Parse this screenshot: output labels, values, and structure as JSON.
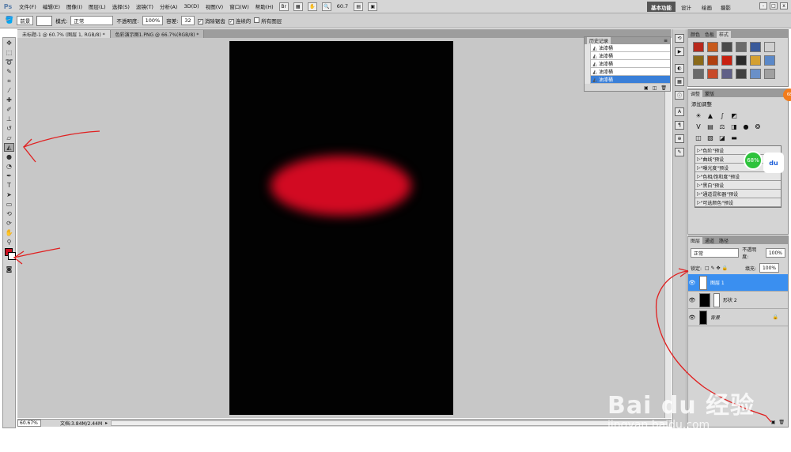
{
  "app": {
    "logo": "Ps"
  },
  "menu": [
    "文件(F)",
    "编辑(E)",
    "图像(I)",
    "图层(L)",
    "选择(S)",
    "滤镜(T)",
    "分析(A)",
    "3D(D)",
    "视图(V)",
    "窗口(W)",
    "帮助(H)"
  ],
  "menubar": {
    "zoom": "60.7",
    "workspaces": [
      "基本功能",
      "设计",
      "绘画",
      "摄影"
    ],
    "window_buttons": [
      "-",
      "□",
      "x"
    ]
  },
  "options": {
    "fill": "前景",
    "mode_label": "模式:",
    "mode_value": "正常",
    "opacity_label": "不透明度:",
    "opacity_value": "100%",
    "tolerance_label": "容差:",
    "tolerance_value": "32",
    "antialias": "消除锯齿",
    "contiguous": "连续的",
    "all_layers": "所有图层"
  },
  "tabs": [
    {
      "label": "未标题-1 @ 60.7% (图层 1, RGB/8) *"
    },
    {
      "label": "色彩演示图1.PNG @ 66.7%(RGB/8) *"
    }
  ],
  "status": {
    "zoom": "60.67%",
    "doc": "文档:3.84M/2.44M"
  },
  "history": {
    "tabs": [
      "历史记录"
    ],
    "items": [
      "油漆桶",
      "油漆桶",
      "油漆桶",
      "油漆桶",
      "油漆桶"
    ]
  },
  "styles_panel": {
    "tabs": [
      "颜色",
      "色板",
      "样式"
    ],
    "swatch_colors": [
      "#b8281c",
      "#c85a1c",
      "#4a4a4a",
      "#6b6b6b",
      "#3a5a9a",
      "#d0d0d0",
      "#8a6a1a",
      "#b04010",
      "#c82010",
      "#2a2a2a",
      "#d4a030",
      "#5a88c8",
      "#6a6a6a",
      "#c84a2a",
      "#606088",
      "#404040",
      "#6a90c8",
      "#a0a0a0"
    ]
  },
  "adjustments": {
    "tabs": [
      "调整",
      "蒙版"
    ],
    "title": "添加调整",
    "presets": [
      "\"色阶\"预设",
      "\"曲线\"预设",
      "\"曝光度\"预设",
      "\"色相/饱和度\"预设",
      "\"黑白\"预设",
      "\"通道混和器\"预设",
      "\"可选颜色\"预设"
    ]
  },
  "layers": {
    "tabs": [
      "图层",
      "通道",
      "路径"
    ],
    "blend_mode": "正常",
    "opacity_label": "不透明度:",
    "opacity_value": "100%",
    "lock_label": "锁定:",
    "fill_label": "填充:",
    "fill_value": "100%",
    "items": [
      {
        "name": "图层 1"
      },
      {
        "name": "形状 2"
      },
      {
        "name": "背景"
      }
    ]
  },
  "badges": {
    "green": "68%",
    "baidu": "du",
    "orange": "68"
  },
  "watermark": {
    "brand": "Bai du 经验",
    "url": "jingyan.baidu.com"
  },
  "colors": {
    "foreground": "#cc1021",
    "blob": "#d20a22",
    "selection": "#3a8ff0",
    "annotation": "#e02020"
  }
}
